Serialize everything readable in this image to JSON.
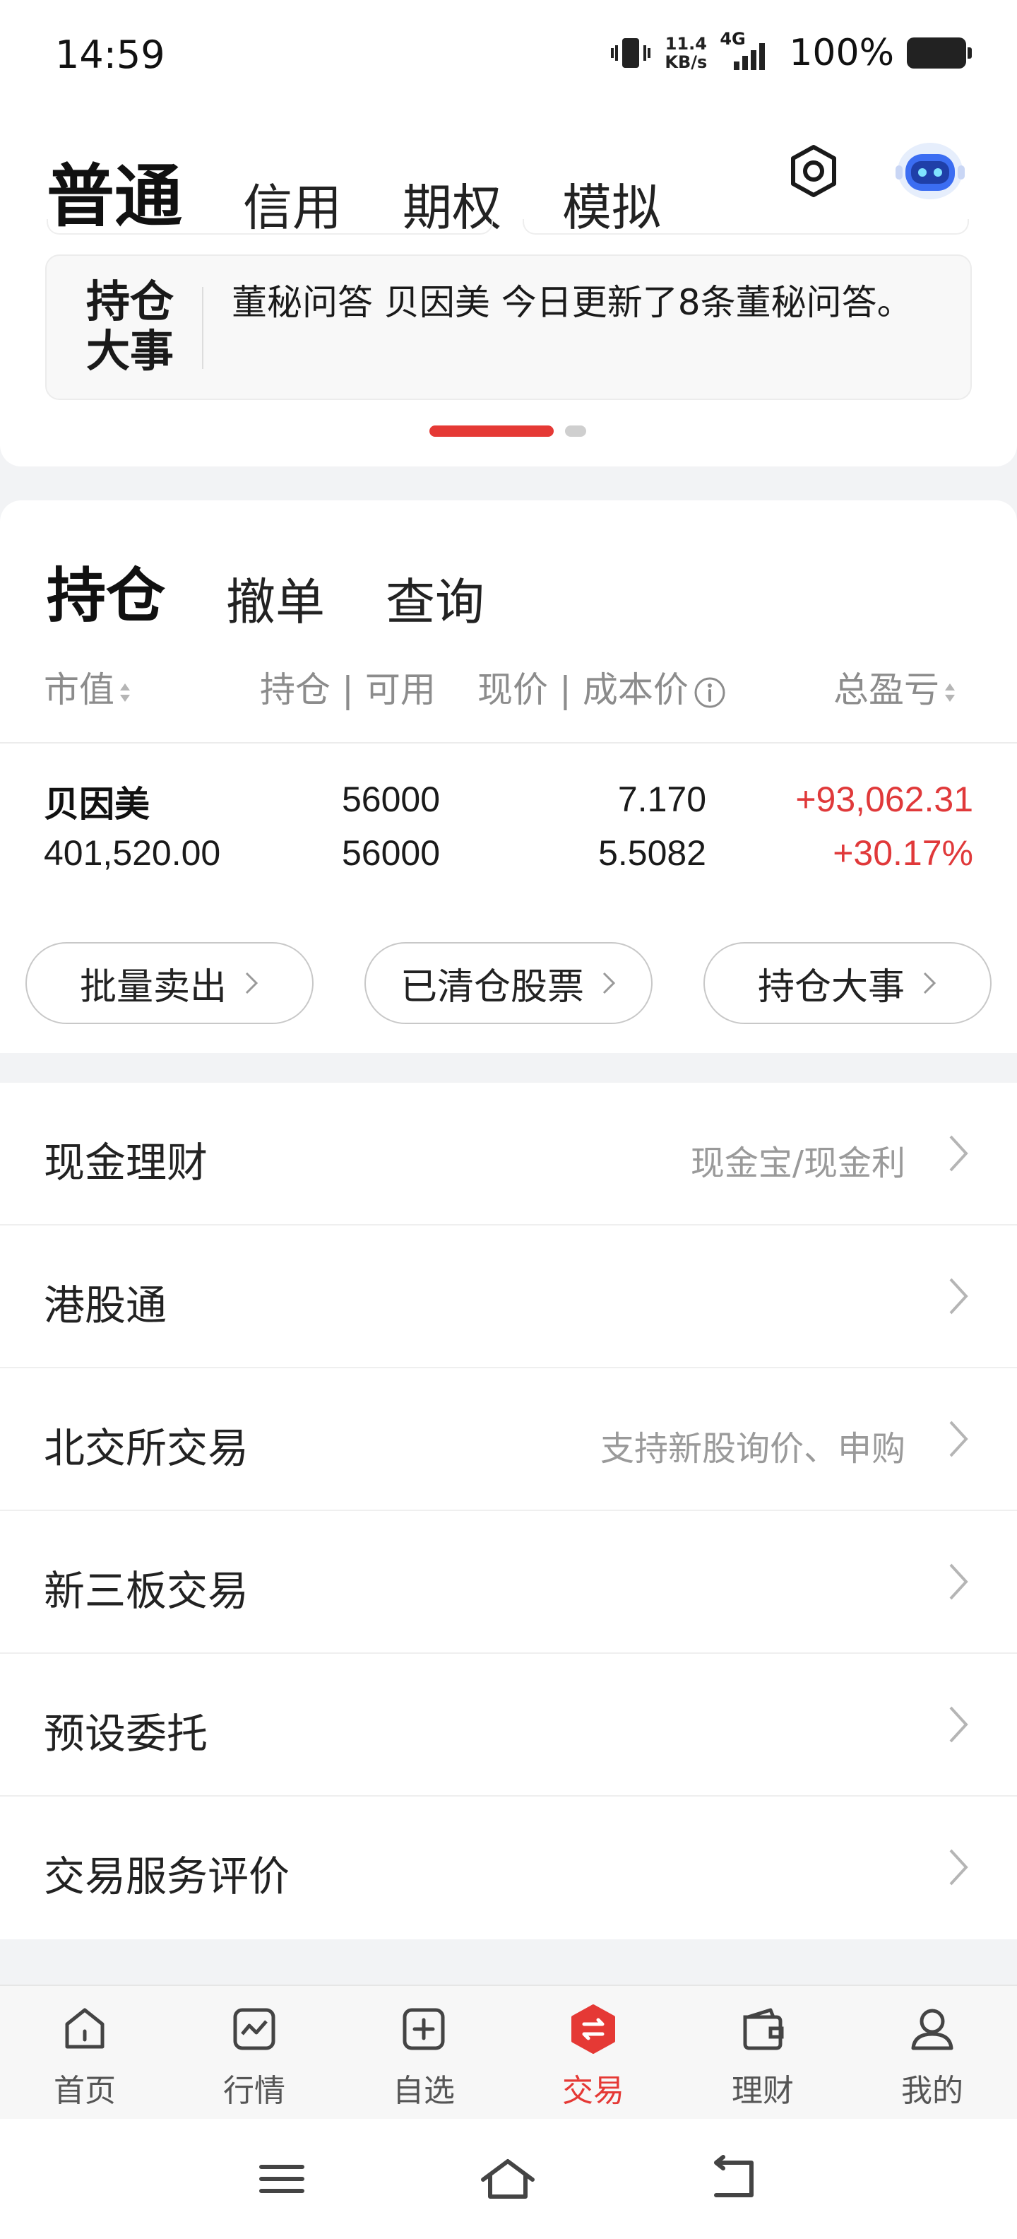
{
  "status_bar": {
    "time": "14:59",
    "net_speed_value": "11.4",
    "net_speed_unit": "KB/s",
    "network_type": "4G",
    "battery_percent": "100%"
  },
  "account_tabs": {
    "items": [
      "普通",
      "信用",
      "期权",
      "模拟"
    ],
    "active": "普通"
  },
  "news_banner": {
    "tag_line1": "持仓",
    "tag_line2": "大事",
    "text": "董秘问答 贝因美 今日更新了8条董秘问答。"
  },
  "holding_tabs": {
    "items": [
      "持仓",
      "撤单",
      "查询"
    ],
    "active": "持仓"
  },
  "columns": {
    "market_value": "市值",
    "position": "持仓",
    "available": "可用",
    "current_price": "现价",
    "cost_price": "成本价",
    "total_pnl": "总盈亏"
  },
  "holdings": [
    {
      "name": "贝因美",
      "market_value": "401,520.00",
      "position": "56000",
      "available": "56000",
      "current_price": "7.170",
      "cost_price": "5.5082",
      "pnl": "+93,062.31",
      "pnl_pct": "+30.17%"
    }
  ],
  "actions": [
    "批量卖出",
    "已清仓股票",
    "持仓大事"
  ],
  "menu": [
    {
      "label": "现金理财",
      "hint": "现金宝/现金利"
    },
    {
      "label": "港股通",
      "hint": ""
    },
    {
      "label": "北交所交易",
      "hint": "支持新股询价、申购"
    },
    {
      "label": "新三板交易",
      "hint": ""
    },
    {
      "label": "预设委托",
      "hint": ""
    },
    {
      "label": "交易服务评价",
      "hint": ""
    }
  ],
  "bottom_nav": {
    "items": [
      {
        "label": "首页",
        "icon": "home-icon"
      },
      {
        "label": "行情",
        "icon": "chart-icon"
      },
      {
        "label": "自选",
        "icon": "plus-square-icon"
      },
      {
        "label": "交易",
        "icon": "trade-icon"
      },
      {
        "label": "理财",
        "icon": "wallet-icon"
      },
      {
        "label": "我的",
        "icon": "user-icon"
      }
    ],
    "active": "交易"
  },
  "colors": {
    "accent": "#e53935",
    "profit": "#e0393a",
    "muted_text": "#8c8c8c"
  }
}
